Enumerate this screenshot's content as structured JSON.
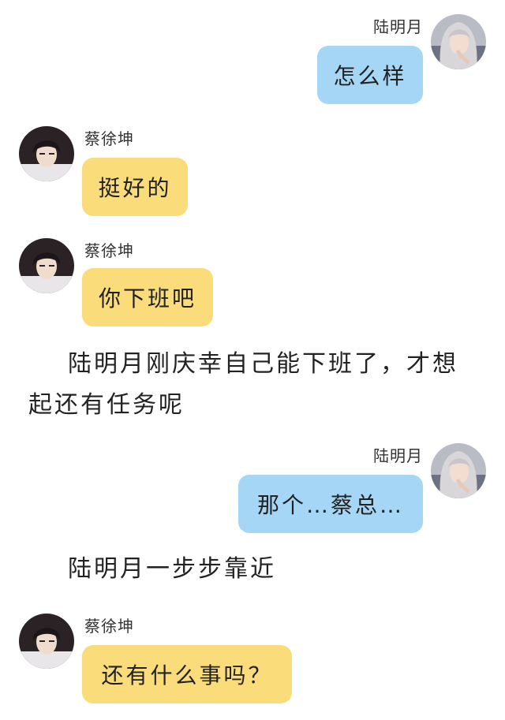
{
  "messages": [
    {
      "sender": "陆明月",
      "side": "right",
      "bubble_color": "#a6d6f6",
      "text": "怎么样"
    },
    {
      "sender": "蔡徐坤",
      "side": "left",
      "bubble_color": "#fbdc7a",
      "text": "挺好的"
    },
    {
      "sender": "蔡徐坤",
      "side": "left",
      "bubble_color": "#fbdc7a",
      "text": "你下班吧"
    },
    {
      "sender": "陆明月",
      "side": "right",
      "bubble_color": "#a6d6f6",
      "text": "那个…蔡总…"
    },
    {
      "sender": "蔡徐坤",
      "side": "left",
      "bubble_color": "#fbdc7a",
      "text": "还有什么事吗？"
    }
  ],
  "narrations": [
    {
      "line1": "陆明月刚庆幸自己能下班了，才想",
      "line2": "起还有任务呢"
    },
    {
      "line1": "陆明月一步步靠近"
    }
  ],
  "avatars": {
    "lu_mingyue": "long-light-hair-woman-avatar",
    "cai_xukun": "dark-hair-man-avatar"
  }
}
